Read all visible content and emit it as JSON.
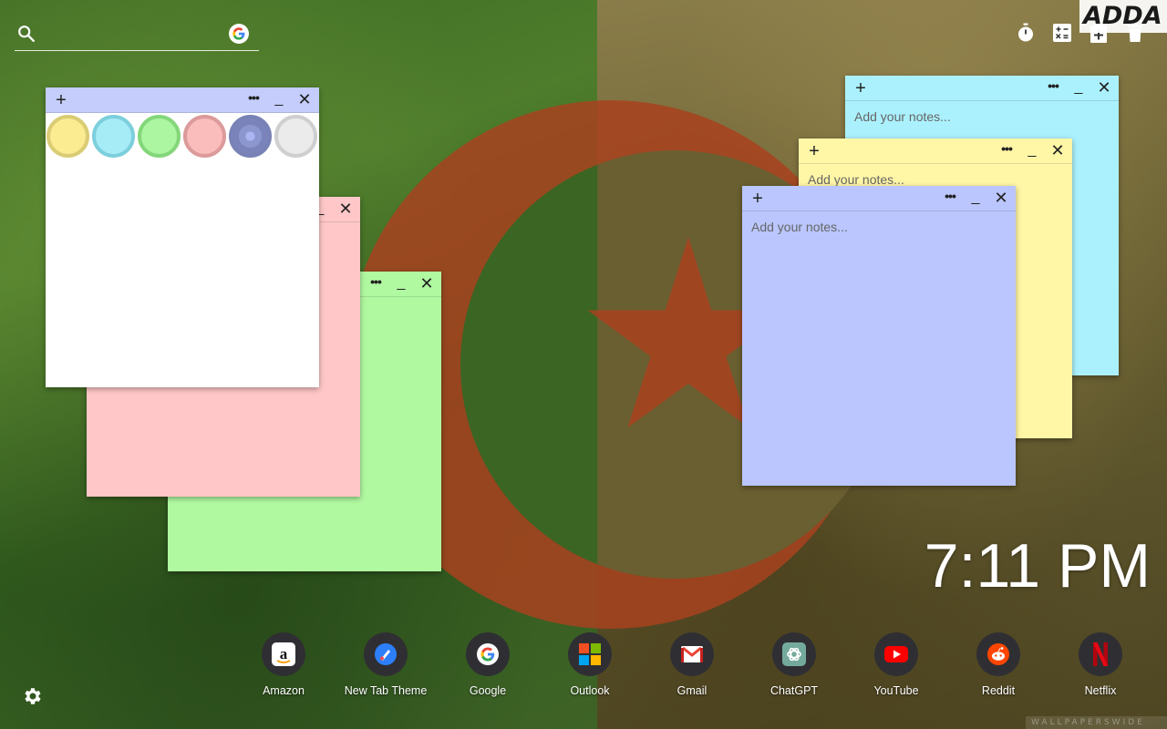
{
  "search": {
    "placeholder": "",
    "value": ""
  },
  "brand_tag": "ADDA G",
  "toolbar": {
    "icons": [
      "timer-icon",
      "calculator-icon",
      "add-note-icon",
      "trash-icon"
    ]
  },
  "notes": {
    "placeholder": "Add your notes...",
    "add_label": "+",
    "menu_label": "•••",
    "minimize_label": "_",
    "close_label": "✕",
    "colors": {
      "green": "#b1f9a1",
      "pink": "#ffc7c7",
      "white": "#ffffff",
      "cyan": "#abf1fd",
      "yellow": "#fff6a6",
      "blue": "#bac6fd"
    }
  },
  "swatches": [
    "yellow",
    "cyan",
    "green",
    "pink",
    "blue",
    "gray"
  ],
  "clock": "7:11 PM",
  "dock": {
    "items": [
      {
        "label": "Amazon",
        "icon": "amazon-icon"
      },
      {
        "label": "New Tab Theme",
        "icon": "new-tab-theme-icon"
      },
      {
        "label": "Google",
        "icon": "google-icon"
      },
      {
        "label": "Outlook",
        "icon": "outlook-icon"
      },
      {
        "label": "Gmail",
        "icon": "gmail-icon"
      },
      {
        "label": "ChatGPT",
        "icon": "chatgpt-icon"
      },
      {
        "label": "YouTube",
        "icon": "youtube-icon"
      },
      {
        "label": "Reddit",
        "icon": "reddit-icon"
      },
      {
        "label": "Netflix",
        "icon": "netflix-icon"
      }
    ]
  },
  "watermark": "WALLPAPERSWIDE"
}
